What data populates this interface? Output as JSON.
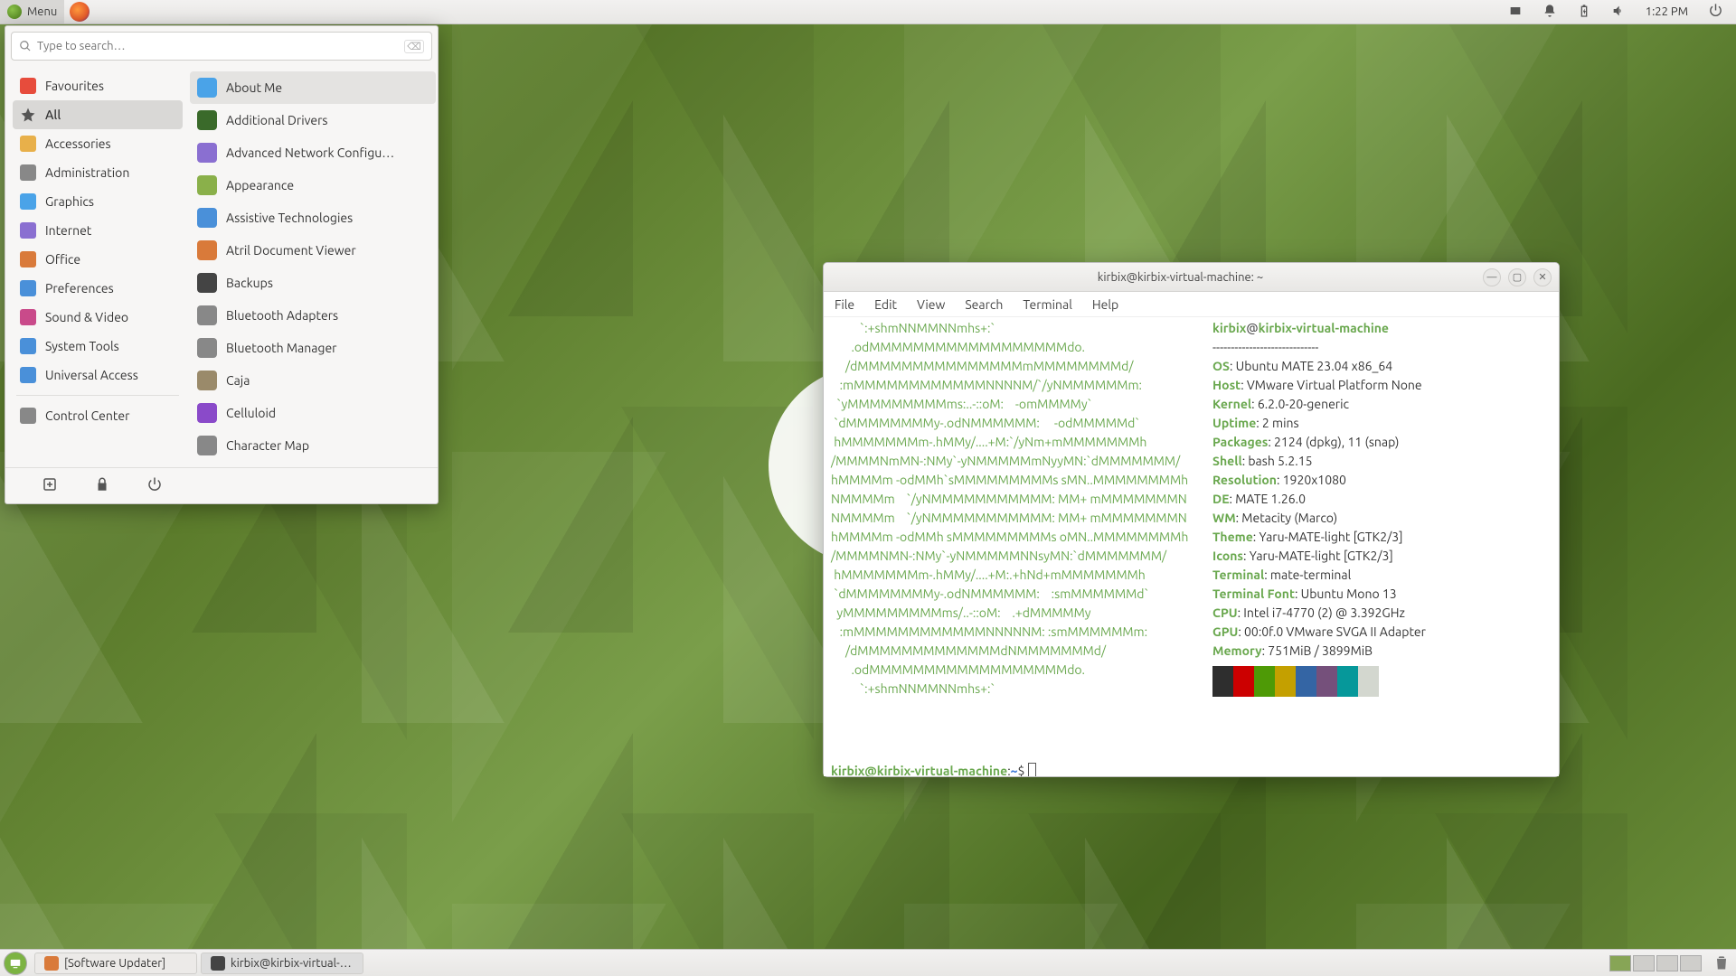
{
  "toppanel": {
    "menu_label": "Menu",
    "clock": "1:22 PM"
  },
  "appmenu": {
    "search_placeholder": "Type to search…",
    "categories": [
      {
        "label": "Favourites",
        "color": "#e74c3c"
      },
      {
        "label": "All",
        "color": "#555",
        "selected": true,
        "icon": "star"
      },
      {
        "label": "Accessories",
        "color": "#e8b04a"
      },
      {
        "label": "Administration",
        "color": "#888"
      },
      {
        "label": "Graphics",
        "color": "#4aa3e8"
      },
      {
        "label": "Internet",
        "color": "#8a6fd1"
      },
      {
        "label": "Office",
        "color": "#d97a3a"
      },
      {
        "label": "Preferences",
        "color": "#4a90d9"
      },
      {
        "label": "Sound & Video",
        "color": "#c94a8a"
      },
      {
        "label": "System Tools",
        "color": "#4a90d9"
      },
      {
        "label": "Universal Access",
        "color": "#4a90d9"
      },
      {
        "label": "Control Center",
        "color": "#888",
        "sep": true
      }
    ],
    "apps": [
      {
        "label": "About Me",
        "color": "#4aa3e8",
        "hl": true
      },
      {
        "label": "Additional Drivers",
        "color": "#3a6a2a"
      },
      {
        "label": "Advanced Network Configu…",
        "color": "#8a6fd1"
      },
      {
        "label": "Appearance",
        "color": "#8ab04a"
      },
      {
        "label": "Assistive Technologies",
        "color": "#4a90d9"
      },
      {
        "label": "Atril Document Viewer",
        "color": "#d97a3a"
      },
      {
        "label": "Backups",
        "color": "#444"
      },
      {
        "label": "Bluetooth Adapters",
        "color": "#888"
      },
      {
        "label": "Bluetooth Manager",
        "color": "#888"
      },
      {
        "label": "Caja",
        "color": "#9a8a6a"
      },
      {
        "label": "Celluloid",
        "color": "#8a4ac9"
      },
      {
        "label": "Character Map",
        "color": "#888"
      }
    ]
  },
  "terminal": {
    "title": "kirbix@kirbix-virtual-machine: ~",
    "menubar": [
      "File",
      "Edit",
      "View",
      "Search",
      "Terminal",
      "Help"
    ],
    "ascii": [
      "          `:+shmNNMMNNmhs+:`",
      "       .odMMMMMMMMMMMMMMMMMMdo.",
      "     /dMMMMMMMMMMMMMMMmMMMMMMMMd/",
      "   :mMMMMMMMMMMMMNNNNM/`/yNMMMMMMm:",
      "  `yMMMMMMMMMms:..-::oM:    -omMMMMy`",
      " `dMMMMMMMMy-.odNMMMMMM:     -odMMMMMd`",
      " hMMMMMMMm-.hMMy/....+M:`/yNm+mMMMMMMMh",
      "/MMMMNmMN-:NMy`-yNMMMMMmNyyMN:`dMMMMMMM/",
      "hMMMMm -odMMh`sMMMMMMMMMs sMN..MMMMMMMMh",
      "NMMMMm    `/yNMMMMMMMMMMM: MM+ mMMMMMMMN",
      "NMMMMm    `/yNMMMMMMMMMMM: MM+ mMMMMMMMN",
      "hMMMMm -odMMh sMMMMMMMMMs oMN..MMMMMMMMh",
      "/MMMMNMN-:NMy`-yNMMMMMNNsyMN:`dMMMMMMM/",
      " hMMMMMMMm-.hMMy/....+M:.+hNd+mMMMMMMMh",
      " `dMMMMMMMMy-.odNMMMMMM:    :smMMMMMMd`",
      "  yMMMMMMMMMms/..-::oM:    .+dMMMMMy",
      "   :mMMMMMMMMMMMMNNNNNM: :smMMMMMMm:",
      "     /dMMMMMMMMMMMMMdNMMMMMMMd/",
      "       .odMMMMMMMMMMMMMMMMMMdo.",
      "          `:+shmNNMMNNmhs+:`"
    ],
    "user": "kirbix",
    "host": "kirbix-virtual-machine",
    "dashes": "-----------------------------",
    "fields": [
      {
        "k": "OS",
        "v": "Ubuntu MATE 23.04 x86_64"
      },
      {
        "k": "Host",
        "v": "VMware Virtual Platform None"
      },
      {
        "k": "Kernel",
        "v": "6.2.0-20-generic"
      },
      {
        "k": "Uptime",
        "v": "2 mins"
      },
      {
        "k": "Packages",
        "v": "2124 (dpkg), 11 (snap)"
      },
      {
        "k": "Shell",
        "v": "bash 5.2.15"
      },
      {
        "k": "Resolution",
        "v": "1920x1080"
      },
      {
        "k": "DE",
        "v": "MATE 1.26.0"
      },
      {
        "k": "WM",
        "v": "Metacity (Marco)"
      },
      {
        "k": "Theme",
        "v": "Yaru-MATE-light [GTK2/3]"
      },
      {
        "k": "Icons",
        "v": "Yaru-MATE-light [GTK2/3]"
      },
      {
        "k": "Terminal",
        "v": "mate-terminal"
      },
      {
        "k": "Terminal Font",
        "v": "Ubuntu Mono 13"
      },
      {
        "k": "CPU",
        "v": "Intel i7-4770 (2) @ 3.392GHz"
      },
      {
        "k": "GPU",
        "v": "00:0f.0 VMware SVGA II Adapter"
      },
      {
        "k": "Memory",
        "v": "751MiB / 3899MiB"
      }
    ],
    "prompt_path": "~",
    "prompt_symbol": "$"
  },
  "taskbar": {
    "tasks": [
      {
        "label": "[Software Updater]",
        "icon": "#d97a3a"
      },
      {
        "label": "kirbix@kirbix-virtual-…",
        "icon": "#444",
        "active": true
      }
    ]
  }
}
